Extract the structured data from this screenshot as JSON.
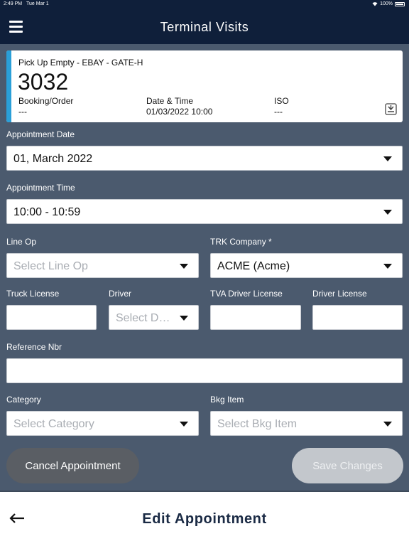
{
  "status_bar": {
    "time": "2:49 PM",
    "date": "Tue Mar 1",
    "battery": "100%"
  },
  "header": {
    "title": "Terminal Visits",
    "menu_icon": "hamburger-menu-icon"
  },
  "card": {
    "subtitle": "Pick Up Empty - EBAY - GATE-H",
    "number": "3032",
    "booking_label": "Booking/Order",
    "booking_value": "---",
    "datetime_label": "Date & Time",
    "datetime_value": "01/03/2022 10:00",
    "iso_label": "ISO",
    "iso_value": "---",
    "action_icon": "download-icon",
    "accent_color": "#2a9fd8"
  },
  "form": {
    "appointment_date": {
      "label": "Appointment Date",
      "value": "01, March 2022"
    },
    "appointment_time": {
      "label": "Appointment Time",
      "value": "10:00 - 10:59"
    },
    "line_op": {
      "label": "Line Op",
      "placeholder": "Select Line Op"
    },
    "trk_company": {
      "label": "TRK Company *",
      "value": "ACME (Acme)"
    },
    "truck_license": {
      "label": "Truck License",
      "value": ""
    },
    "driver": {
      "label": "Driver",
      "placeholder": "Select D…"
    },
    "tva_driver_license": {
      "label": "TVA Driver License",
      "value": ""
    },
    "driver_license": {
      "label": "Driver License",
      "value": ""
    },
    "reference_nbr": {
      "label": "Reference Nbr",
      "value": ""
    },
    "category": {
      "label": "Category",
      "placeholder": "Select Category"
    },
    "bkg_item": {
      "label": "Bkg Item",
      "placeholder": "Select Bkg Item"
    }
  },
  "buttons": {
    "cancel": "Cancel Appointment",
    "save": "Save Changes"
  },
  "footer": {
    "title": "Edit Appointment",
    "back_icon": "back-arrow-icon"
  },
  "colors": {
    "header_bg": "#0f1f3a",
    "page_bg": "#4b5a6e",
    "cancel_bg": "#5a5e64",
    "save_bg_disabled": "#c3c7cc",
    "footer_title": "#1a2a44"
  }
}
